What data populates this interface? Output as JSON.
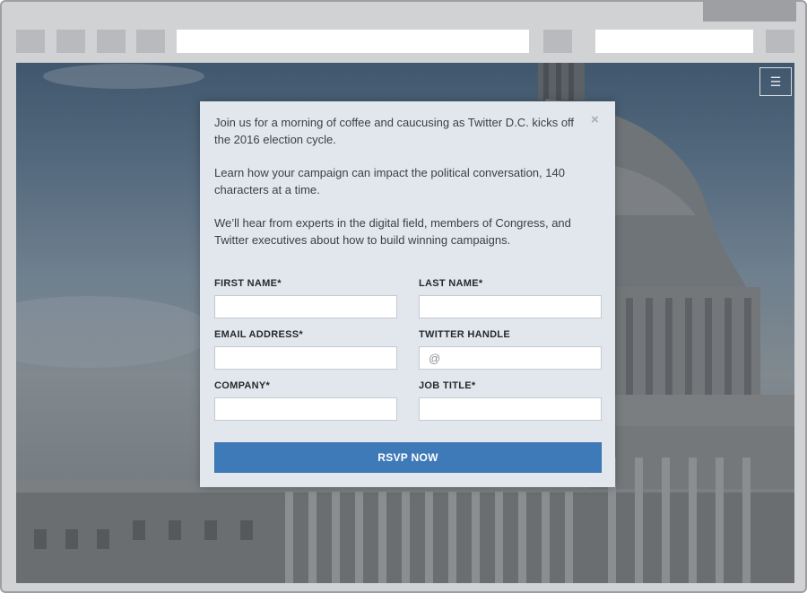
{
  "browser": {
    "toolbar_buttons": [
      "back-button",
      "forward-button",
      "reload-button",
      "home-button"
    ],
    "address_value": "",
    "search_value": ""
  },
  "nav": {
    "menu_icon": "☰"
  },
  "modal": {
    "close_icon": "×",
    "intro": [
      "Join us for a morning of coffee and caucusing as Twitter D.C. kicks off the 2016 election cycle.",
      "Learn how your campaign can impact the political conversation, 140 characters at a time.",
      "We’ll hear from experts in the digital field, members of Congress, and Twitter executives about how to build winning campaigns."
    ],
    "form": {
      "first_name": {
        "label": "FIRST NAME*",
        "placeholder": ""
      },
      "last_name": {
        "label": "LAST NAME*",
        "placeholder": ""
      },
      "email": {
        "label": "EMAIL ADDRESS*",
        "placeholder": ""
      },
      "twitter": {
        "label": "TWITTER HANDLE",
        "placeholder": "@"
      },
      "company": {
        "label": "COMPANY*",
        "placeholder": ""
      },
      "job_title": {
        "label": "JOB TITLE*",
        "placeholder": ""
      },
      "submit_label": "RSVP NOW"
    }
  },
  "colors": {
    "button": "#3f7ab8",
    "modal_bg": "#e2e7ee",
    "frame": "#d1d2d4"
  }
}
